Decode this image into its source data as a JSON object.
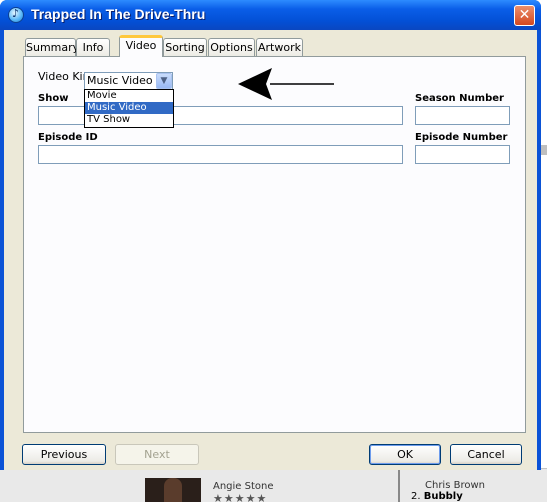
{
  "window": {
    "title": "Trapped In The Drive-Thru"
  },
  "tabs": [
    {
      "label": "Summary",
      "active": false
    },
    {
      "label": "Info",
      "active": false
    },
    {
      "label": "Video",
      "active": true
    },
    {
      "label": "Sorting",
      "active": false
    },
    {
      "label": "Options",
      "active": false
    },
    {
      "label": "Artwork",
      "active": false
    }
  ],
  "video_tab": {
    "video_kind_label": "Video Kind:",
    "video_kind_value": "Music Video",
    "video_kind_options": [
      "Movie",
      "Music Video",
      "TV Show"
    ],
    "video_kind_highlighted": "Music Video",
    "show_label": "Show",
    "show_value": "",
    "season_number_label": "Season Number",
    "season_number_value": "",
    "episode_id_label": "Episode ID",
    "episode_id_value": "",
    "episode_number_label": "Episode Number",
    "episode_number_value": ""
  },
  "buttons": {
    "previous": "Previous",
    "next": "Next",
    "ok": "OK",
    "cancel": "Cancel"
  },
  "background_app": {
    "artist_left": "Angie Stone",
    "rating_stars": "★★★★★",
    "artist_right": "Chris Brown",
    "track_number": "2.",
    "track_title": "Bubbly"
  }
}
